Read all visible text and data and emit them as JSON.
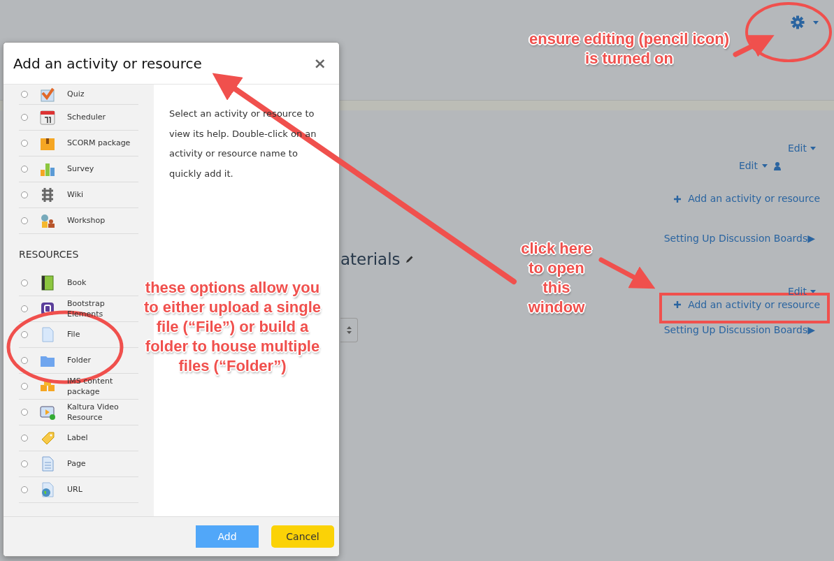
{
  "page": {
    "blocks": [
      {
        "kind": "edit-menu",
        "label": "Edit"
      },
      {
        "kind": "edit-menu-user",
        "label": "Edit"
      },
      {
        "kind": "add-link",
        "label": "Add an activity or resource"
      },
      {
        "kind": "nav-link",
        "label": "Setting Up Discussion Boards▶"
      },
      {
        "kind": "section-title",
        "label": "aterials"
      },
      {
        "kind": "edit-menu",
        "label": "Edit"
      },
      {
        "kind": "add-link",
        "label": "Add an activity or resource"
      },
      {
        "kind": "select-nav",
        "label": "Setting Up Discussion Boards▶"
      }
    ]
  },
  "modal": {
    "title": "Add an activity or resource",
    "close": "×",
    "groups": [
      {
        "items": [
          {
            "label": "Quiz",
            "selected": false
          },
          {
            "label": "Scheduler",
            "selected": false
          },
          {
            "label": "SCORM package",
            "selected": false
          },
          {
            "label": "Survey",
            "selected": false
          },
          {
            "label": "Wiki",
            "selected": false
          },
          {
            "label": "Workshop",
            "selected": false
          }
        ]
      },
      {
        "heading": "RESOURCES",
        "items": [
          {
            "label": "Book",
            "selected": false
          },
          {
            "label": "Bootstrap Elements",
            "selected": false
          },
          {
            "label": "File",
            "selected": false
          },
          {
            "label": "Folder",
            "selected": false
          },
          {
            "label": "IMS content package",
            "selected": false
          },
          {
            "label": "Kaltura Video Resource",
            "selected": false
          },
          {
            "label": "Label",
            "selected": false
          },
          {
            "label": "Page",
            "selected": false
          },
          {
            "label": "URL",
            "selected": false
          }
        ]
      }
    ],
    "help": "Select an activity or resource to view its help. Double-click on an activity or resource name to quickly add it.",
    "buttons": [
      {
        "kind": "primary",
        "label": "Add"
      },
      {
        "kind": "secondary",
        "label": "Cancel"
      }
    ]
  },
  "annotations": [
    {
      "text": "ensure editing (pencil icon) is turned on"
    },
    {
      "text": "these options allow you to either upload a single file (“File”) or build a folder to house multiple files (“Folder”)"
    },
    {
      "text": "click here to open this window"
    }
  ]
}
